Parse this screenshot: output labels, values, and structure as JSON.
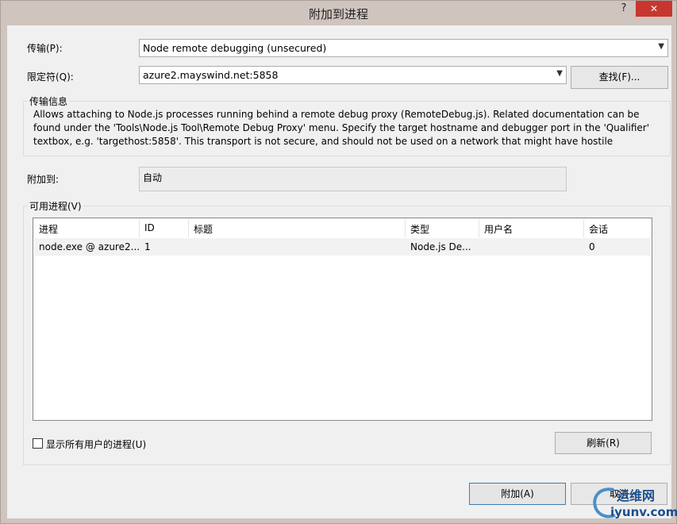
{
  "window": {
    "title": "附加到进程",
    "help_label": "?",
    "close_label": "✕"
  },
  "transport": {
    "label": "传输(P):",
    "value": "Node remote debugging (unsecured)"
  },
  "qualifier": {
    "label": "限定符(Q):",
    "value": "azure2.mayswind.net:5858",
    "find_button": "查找(F)..."
  },
  "transport_info": {
    "group_title": "传输信息",
    "text": "Allows attaching to Node.js processes running behind a remote debug proxy (RemoteDebug.js). Related documentation can be found under the 'Tools\\Node.js Tool\\Remote Debug Proxy' menu. Specify the target hostname and debugger port in the 'Qualifier' textbox, e.g. 'targethost:5858'. This transport is not secure, and should not be used on a network that might have hostile"
  },
  "attach_to": {
    "label": "附加到:",
    "value": "自动"
  },
  "available_processes": {
    "group_title": "可用进程(V)",
    "columns": [
      "进程",
      "ID",
      "标题",
      "类型",
      "用户名",
      "会话"
    ],
    "rows": [
      [
        "node.exe @ azure2....",
        "1",
        "",
        "Node.js De...",
        "",
        "0"
      ]
    ],
    "show_all_users_label": "显示所有用户的进程(U)",
    "refresh_button": "刷新(R)"
  },
  "footer": {
    "attach_button": "附加(A)",
    "cancel_button": "取消"
  },
  "watermark": {
    "top": "运维网",
    "bottom": "iyunv.com"
  },
  "colors": {
    "close_button": "#c7372f",
    "frame": "#cfc4be",
    "client": "#f0f0f0",
    "watermark": "#1a4f8f"
  }
}
